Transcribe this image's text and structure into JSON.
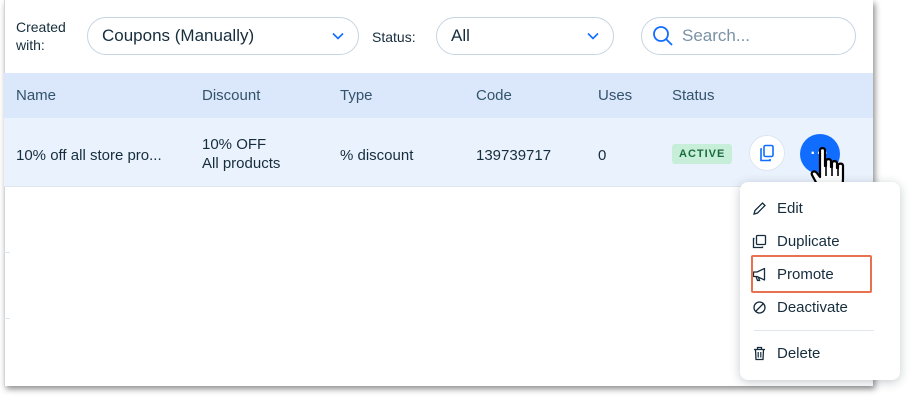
{
  "filters": {
    "created_label": "Created with:",
    "created_value": "Coupons (Manually)",
    "status_label": "Status:",
    "status_value": "All",
    "search_placeholder": "Search..."
  },
  "table": {
    "columns": [
      "Name",
      "Discount",
      "Type",
      "Code",
      "Uses",
      "Status"
    ],
    "rows": [
      {
        "name": "10% off all store pro...",
        "discount_line1": "10% OFF",
        "discount_line2": "All products",
        "type": "% discount",
        "code": "139739717",
        "uses": "0",
        "status": "ACTIVE"
      }
    ]
  },
  "actions": {
    "more_label": "···"
  },
  "menu": {
    "items": [
      "Edit",
      "Duplicate",
      "Promote",
      "Deactivate",
      "Delete"
    ]
  },
  "colors": {
    "accent": "#116dff",
    "header_bg": "#dbe7fb",
    "row_bg": "#eaf2fd",
    "active_badge": "#c7eed8",
    "highlight": "#e8724f"
  }
}
